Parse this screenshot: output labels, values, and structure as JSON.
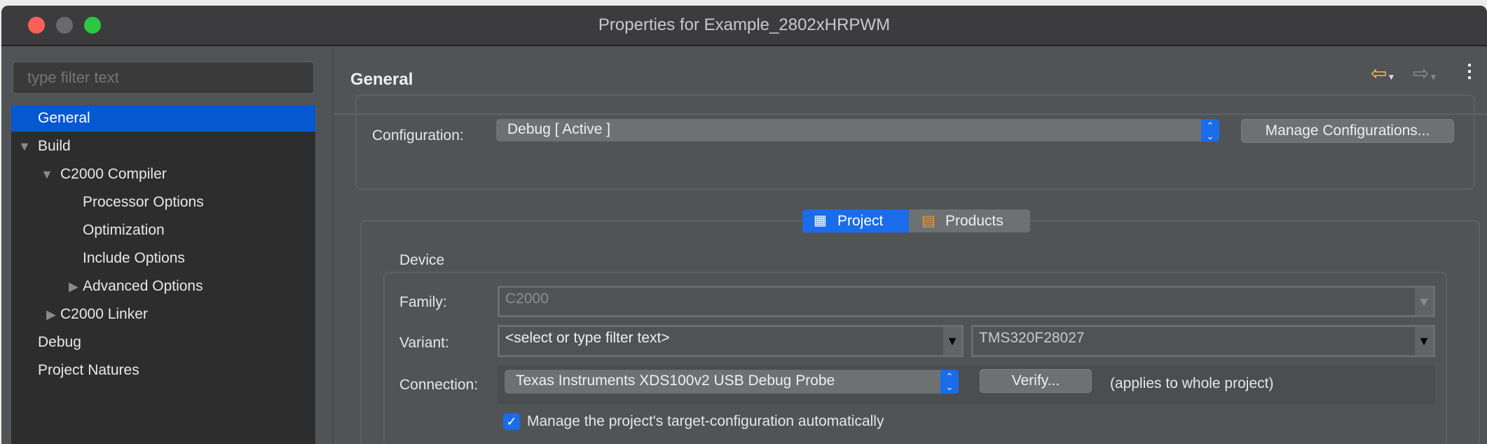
{
  "window": {
    "title": "Properties for Example_2802xHRPWM"
  },
  "sidebar": {
    "filter_placeholder": "type filter text",
    "items": [
      {
        "label": "General"
      },
      {
        "label": "Build"
      },
      {
        "label": "C2000 Compiler"
      },
      {
        "label": "Processor Options"
      },
      {
        "label": "Optimization"
      },
      {
        "label": "Include Options"
      },
      {
        "label": "Advanced Options"
      },
      {
        "label": "C2000 Linker"
      },
      {
        "label": "Debug"
      },
      {
        "label": "Project Natures"
      }
    ]
  },
  "header": {
    "title": "General"
  },
  "config": {
    "label": "Configuration:",
    "value": "Debug  [ Active ]",
    "manage_label": "Manage Configurations..."
  },
  "tabs": [
    {
      "label": "Project"
    },
    {
      "label": "Products"
    }
  ],
  "device": {
    "group_label": "Device",
    "family_label": "Family:",
    "family_value": "C2000",
    "variant_label": "Variant:",
    "variant_filter": "<select or type filter text>",
    "variant_value": "TMS320F28027",
    "connection_label": "Connection:",
    "connection_value": "Texas Instruments XDS100v2 USB Debug Probe",
    "verify_label": "Verify...",
    "applies_text": "(applies to whole project)",
    "manage_checkbox_label": "Manage the project's target-configuration automatically",
    "manage_checked": true
  },
  "colors": {
    "accent": "#0558d0",
    "close": "#fe5f57",
    "zoom": "#2ac940"
  }
}
